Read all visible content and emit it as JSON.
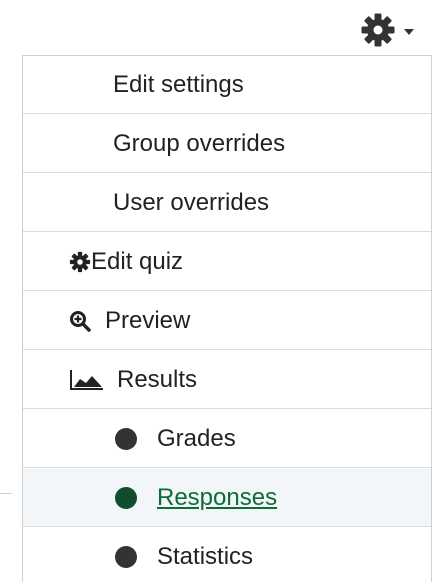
{
  "menu": {
    "items": [
      {
        "label": "Edit settings"
      },
      {
        "label": "Group overrides"
      },
      {
        "label": "User overrides"
      },
      {
        "label": "Edit quiz"
      },
      {
        "label": "Preview"
      },
      {
        "label": "Results"
      },
      {
        "label": "Grades"
      },
      {
        "label": "Responses"
      },
      {
        "label": "Statistics"
      }
    ]
  },
  "trigger": {
    "icon": "gear-icon",
    "caret_icon": "caret-down-icon"
  },
  "icons": {
    "edit_quiz": "gear-icon",
    "preview": "zoom-in-icon",
    "results": "area-chart-icon",
    "subitem_bullet": "bullet-dot-icon"
  },
  "colors": {
    "active_link": "#0f6b3a",
    "active_dot": "#0f4d2e",
    "active_row_bg": "#f3f6f8",
    "text": "#222222",
    "border": "#dcdcdc"
  },
  "state": {
    "active_item": "Responses"
  }
}
